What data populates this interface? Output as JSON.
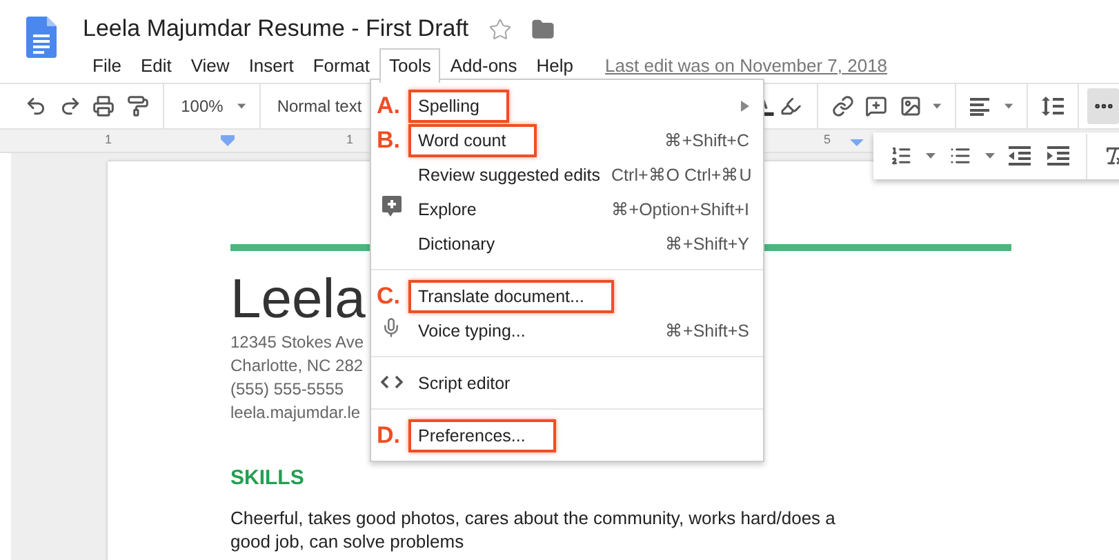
{
  "document_title": "Leela Majumdar Resume - First Draft",
  "starred": false,
  "menu_bar": [
    {
      "label": "File",
      "selected": false
    },
    {
      "label": "Edit",
      "selected": false
    },
    {
      "label": "View",
      "selected": false
    },
    {
      "label": "Insert",
      "selected": false
    },
    {
      "label": "Format",
      "selected": false
    },
    {
      "label": "Tools",
      "selected": true
    },
    {
      "label": "Add-ons",
      "selected": false
    },
    {
      "label": "Help",
      "selected": false
    }
  ],
  "last_edit": "Last edit was on November 7, 2018",
  "toolbar": {
    "zoom": "100%",
    "style": "Normal text",
    "more_selected": true
  },
  "ruler": [
    "1",
    "1",
    "5"
  ],
  "tools_menu": [
    {
      "kind": "submenu",
      "label": "Spelling",
      "marker": "A."
    },
    {
      "kind": "plain",
      "label": "Word count",
      "shortcut": "⌘+Shift+C",
      "marker": "B."
    },
    {
      "kind": "plain",
      "label": "Review suggested edits",
      "shortcut": "Ctrl+⌘O Ctrl+⌘U"
    },
    {
      "kind": "explore",
      "label": "Explore",
      "shortcut": "⌘+Option+Shift+I"
    },
    {
      "kind": "plain",
      "label": "Dictionary",
      "shortcut": "⌘+Shift+Y"
    },
    {
      "kind": "separator"
    },
    {
      "kind": "plain",
      "label": "Translate document...",
      "marker": "C."
    },
    {
      "kind": "voice",
      "label": "Voice typing...",
      "shortcut": "⌘+Shift+S"
    },
    {
      "kind": "separator"
    },
    {
      "kind": "script",
      "label": "Script editor"
    },
    {
      "kind": "separator"
    },
    {
      "kind": "plain",
      "label": "Preferences...",
      "marker": "D."
    }
  ],
  "document": {
    "name": "Leela",
    "address": [
      "12345 Stokes Ave",
      "Charlotte, NC 282",
      "(555) 555-5555",
      "leela.majumdar.le"
    ],
    "heading": "SKILLS",
    "paragraph": "Cheerful, takes good photos, cares about the community, works hard/does a good job, can solve problems"
  }
}
